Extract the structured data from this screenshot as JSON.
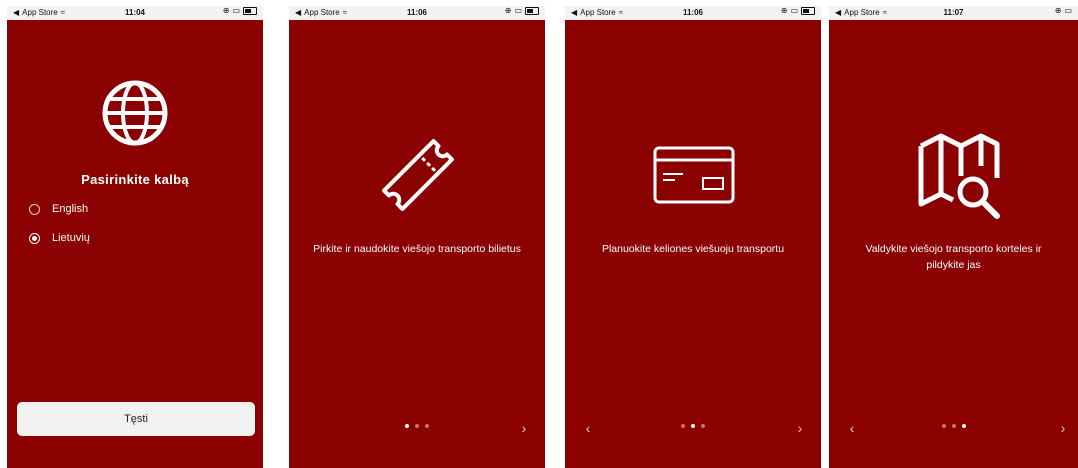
{
  "status": {
    "back_app": "App Store",
    "times": [
      "11:04",
      "11:06",
      "11:06",
      "11:07"
    ]
  },
  "screen1": {
    "title": "Pasirinkite kalbą",
    "options": [
      {
        "label": "English",
        "selected": false
      },
      {
        "label": "Lietuvių",
        "selected": true
      }
    ],
    "continue_label": "Tęsti"
  },
  "screen2": {
    "caption": "Pirkite ir naudokite viešojo transporto bilietus",
    "active_dot": 1
  },
  "screen3": {
    "caption": "Planuokite keliones viešuoju transportu",
    "active_dot": 2
  },
  "screen4": {
    "caption": "Valdykite viešojo transporto korteles ir pildykite jas",
    "active_dot": 3
  },
  "glyphs": {
    "next": "›",
    "prev": "‹",
    "back_arrow": "◀",
    "wifi": "≈"
  },
  "colors": {
    "brand_red": "#8b0000",
    "button_bg": "#f1f1f1"
  }
}
